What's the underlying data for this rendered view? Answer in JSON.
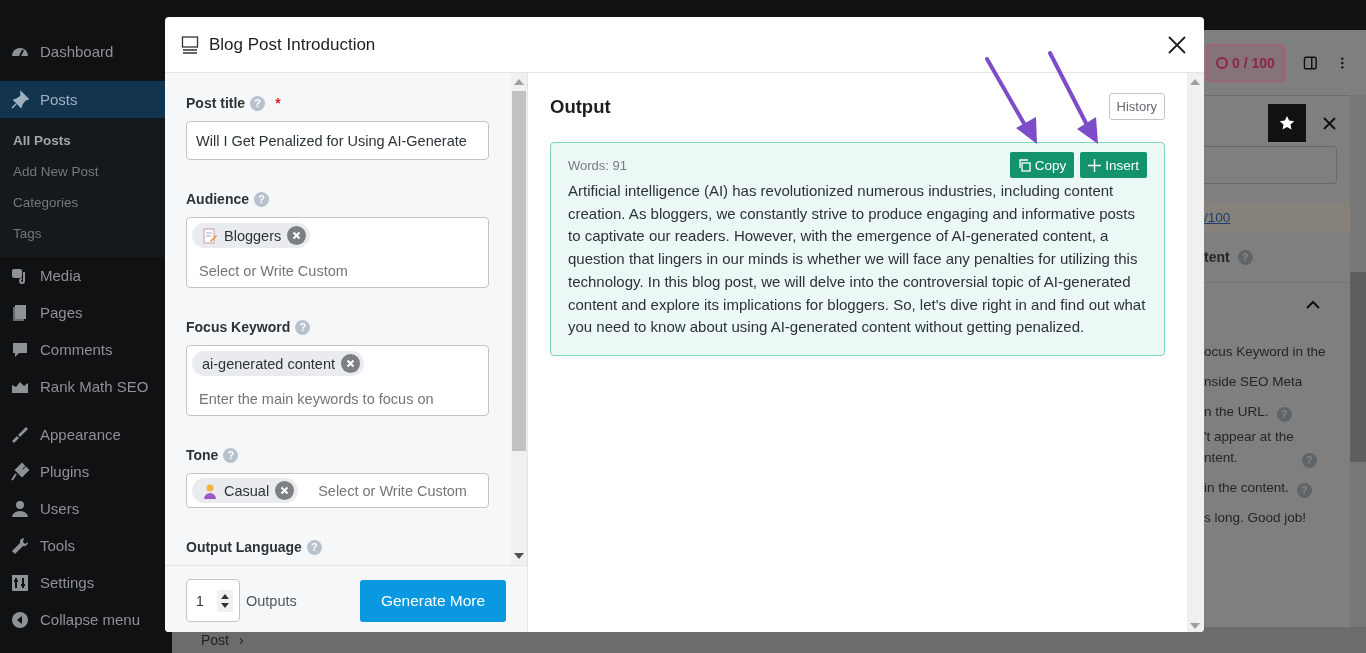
{
  "sidebar": {
    "groups": [
      [
        {
          "label": "Dashboard",
          "selected": false
        }
      ],
      [
        {
          "label": "Posts",
          "selected": true,
          "children": [
            {
              "label": "All Posts",
              "selected": true
            },
            {
              "label": "Add New Post",
              "selected": false
            },
            {
              "label": "Categories",
              "selected": false
            },
            {
              "label": "Tags",
              "selected": false
            }
          ]
        },
        {
          "label": "Media",
          "selected": false
        },
        {
          "label": "Pages",
          "selected": false
        },
        {
          "label": "Comments",
          "selected": false
        },
        {
          "label": "Rank Math SEO",
          "selected": false
        }
      ],
      [
        {
          "label": "Appearance",
          "selected": false
        },
        {
          "label": "Plugins",
          "selected": false
        },
        {
          "label": "Users",
          "selected": false
        },
        {
          "label": "Tools",
          "selected": false
        },
        {
          "label": "Settings",
          "selected": false
        },
        {
          "label": "Collapse menu",
          "selected": false
        }
      ]
    ]
  },
  "editor_sidebar": {
    "score": "0 / 100",
    "score_link": "/100",
    "heading": "tent",
    "help": "?",
    "checks": [
      {
        "lines": [
          "ocus Keyword in the"
        ]
      },
      {
        "lines": [
          "nside SEO Meta"
        ]
      },
      {
        "lines": [
          "n the URL."
        ],
        "help": "?"
      },
      {
        "lines": [
          "'t appear at the",
          "ntent."
        ],
        "help": "?"
      },
      {
        "lines": [
          "in the content."
        ],
        "help": "?"
      },
      {
        "lines": [
          "s long. Good job!"
        ]
      }
    ]
  },
  "breadcrumb": {
    "label": "Post",
    "separator": "›"
  },
  "dialog": {
    "title": "Blog Post Introduction",
    "fields": [
      {
        "kind": "text",
        "label": "Post title",
        "help": "?",
        "required_mark": "*",
        "value": "Will I Get Penalized for Using AI-Generate"
      },
      {
        "kind": "tags",
        "label": "Audience",
        "help": "?",
        "tags": [
          {
            "label": "Bloggers"
          }
        ],
        "placeholder": "Select or Write Custom"
      },
      {
        "kind": "tags",
        "label": "Focus Keyword",
        "help": "?",
        "tags": [
          {
            "label": "ai-generated content"
          }
        ],
        "placeholder": "Enter the main keywords to focus on"
      },
      {
        "kind": "tags-inline",
        "label": "Tone",
        "help": "?",
        "tags": [
          {
            "label": "Casual"
          }
        ],
        "placeholder": "Select or Write Custom"
      },
      {
        "kind": "heading",
        "label": "Output Language",
        "help": "?"
      }
    ],
    "outputs": {
      "value": "1",
      "label": "Outputs"
    },
    "generate_button": "Generate More",
    "output": {
      "heading": "Output",
      "history_button": "History",
      "results": [
        {
          "word_count": "Words: 91",
          "copy_button": "Copy",
          "insert_button": "Insert",
          "text": "Artificial intelligence (AI) has revolutionized numerous industries, including content creation. As bloggers, we constantly strive to produce engaging and informative posts to captivate our readers. However, with the emergence of AI-generated content, a question that lingers in our minds is whether we will face any penalties for utilizing this technology. In this blog post, we will delve into the controversial topic of AI-generated content and explore its implications for bloggers. So, let's dive right in and find out what you need to know about using AI-generated content without getting penalized."
        }
      ]
    }
  }
}
